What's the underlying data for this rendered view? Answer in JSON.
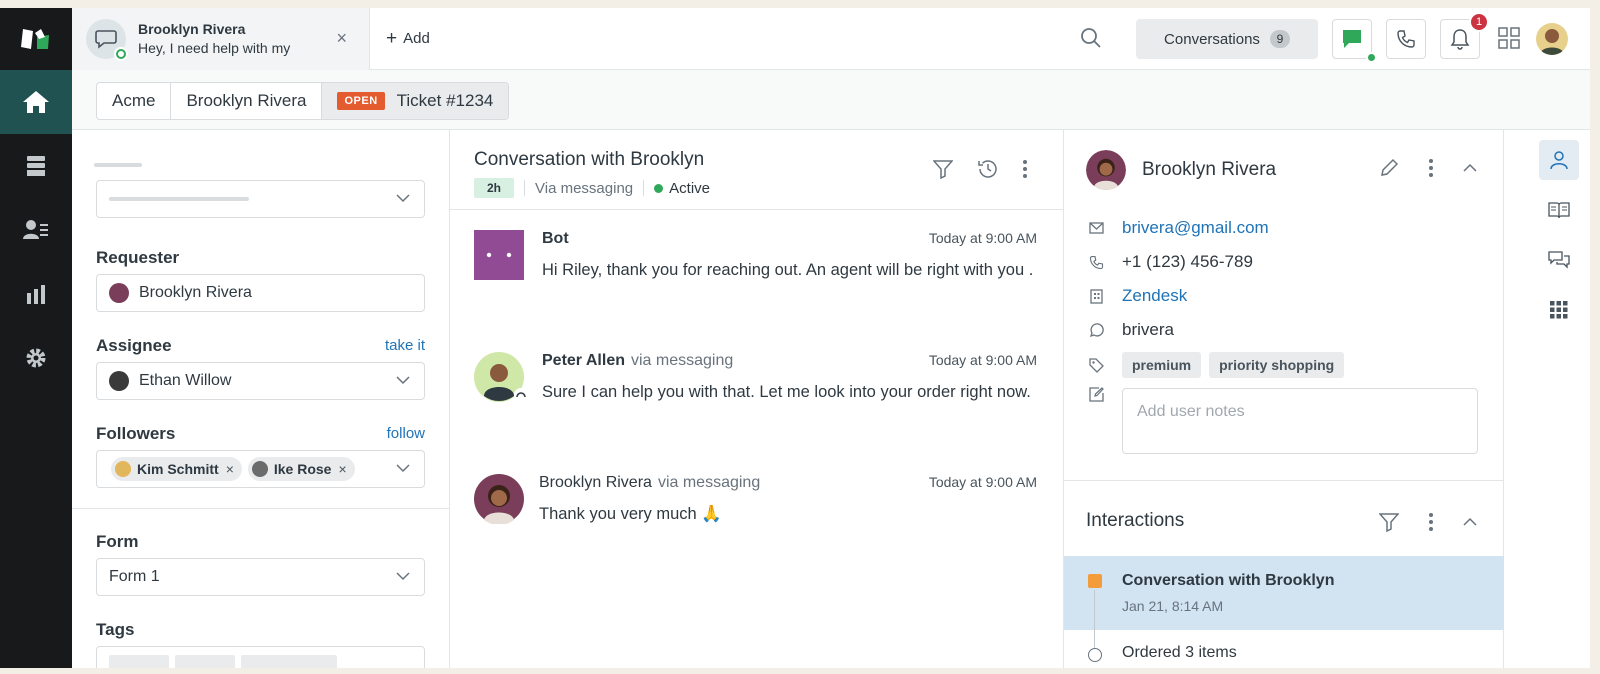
{
  "topbar": {
    "conversation_tab": {
      "name": "Brooklyn Rivera",
      "preview": "Hey, I need help with my"
    },
    "add_label": "Add",
    "conversations_label": "Conversations",
    "conversations_count": "9",
    "notifications_count": "1"
  },
  "breadcrumb": {
    "org": "Acme",
    "requester": "Brooklyn Rivera",
    "status": "OPEN",
    "ticket": "Ticket #1234"
  },
  "left_panel": {
    "requester_label": "Requester",
    "requester_value": "Brooklyn Rivera",
    "assignee_label": "Assignee",
    "assignee_link": "take it",
    "assignee_value": "Ethan Willow",
    "followers_label": "Followers",
    "followers_link": "follow",
    "followers": [
      {
        "name": "Kim Schmitt"
      },
      {
        "name": "Ike Rose"
      }
    ],
    "form_label": "Form",
    "form_value": "Form 1",
    "tags_label": "Tags"
  },
  "conversation": {
    "title": "Conversation with Brooklyn",
    "age": "2h",
    "channel": "Via messaging",
    "status": "Active",
    "messages": [
      {
        "sender": "Bot",
        "via": "",
        "time": "Today at 9:00 AM",
        "text": "Hi Riley, thank you for reaching out. An agent will be right with you ."
      },
      {
        "sender": "Peter Allen",
        "via": "via messaging",
        "time": "Today at 9:00 AM",
        "text": "Sure I can help you with that. Let me look into your order right now."
      },
      {
        "sender": "Brooklyn Rivera",
        "via": "via messaging",
        "time": "Today at 9:00 AM",
        "text": "Thank you very much 🙏"
      }
    ]
  },
  "customer": {
    "name": "Brooklyn Rivera",
    "email": "brivera@gmail.com",
    "phone": "+1 (123) 456-789",
    "company": "Zendesk",
    "whatsapp": "brivera",
    "tags": [
      "premium",
      "priority shopping"
    ],
    "notes_placeholder": "Add user notes"
  },
  "interactions": {
    "title": "Interactions",
    "items": [
      {
        "title": "Conversation with Brooklyn",
        "date": "Jan 21, 8:14 AM"
      },
      {
        "title": "Ordered 3 items",
        "date": ""
      }
    ]
  },
  "colors": {
    "rail": "#17191a",
    "rail_active": "#1f5250",
    "accent_link": "#1f73b7",
    "open_status": "#e35b2e",
    "active_green": "#2fa85a",
    "selected_interaction": "#d2e3f2"
  }
}
